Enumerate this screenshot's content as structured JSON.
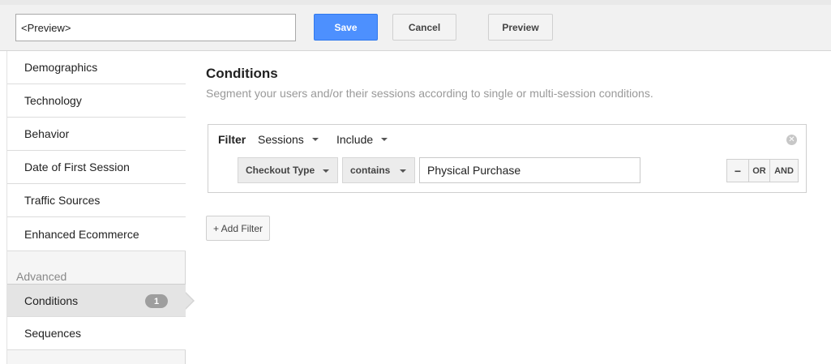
{
  "topbar": {
    "segment_name": "<Preview>",
    "save_label": "Save",
    "cancel_label": "Cancel",
    "preview_label": "Preview",
    "accent_color": "#4d90fe"
  },
  "sidebar": {
    "items": [
      {
        "label": "Demographics"
      },
      {
        "label": "Technology"
      },
      {
        "label": "Behavior"
      },
      {
        "label": "Date of First Session"
      },
      {
        "label": "Traffic Sources"
      },
      {
        "label": "Enhanced Ecommerce"
      }
    ],
    "advanced_heading": "Advanced",
    "advanced_items": [
      {
        "label": "Conditions",
        "badge": "1",
        "active": true
      },
      {
        "label": "Sequences"
      }
    ]
  },
  "main": {
    "title": "Conditions",
    "subtitle": "Segment your users and/or their sessions according to single or multi-session conditions.",
    "filter": {
      "label": "Filter",
      "scope": "Sessions",
      "mode": "Include",
      "dimension": "Checkout Type",
      "operator": "contains",
      "value": "Physical Purchase",
      "logic_minus": "−",
      "logic_or": "OR",
      "logic_and": "AND",
      "remove_icon": "close-circle-icon"
    },
    "add_filter_label": "+ Add Filter"
  }
}
